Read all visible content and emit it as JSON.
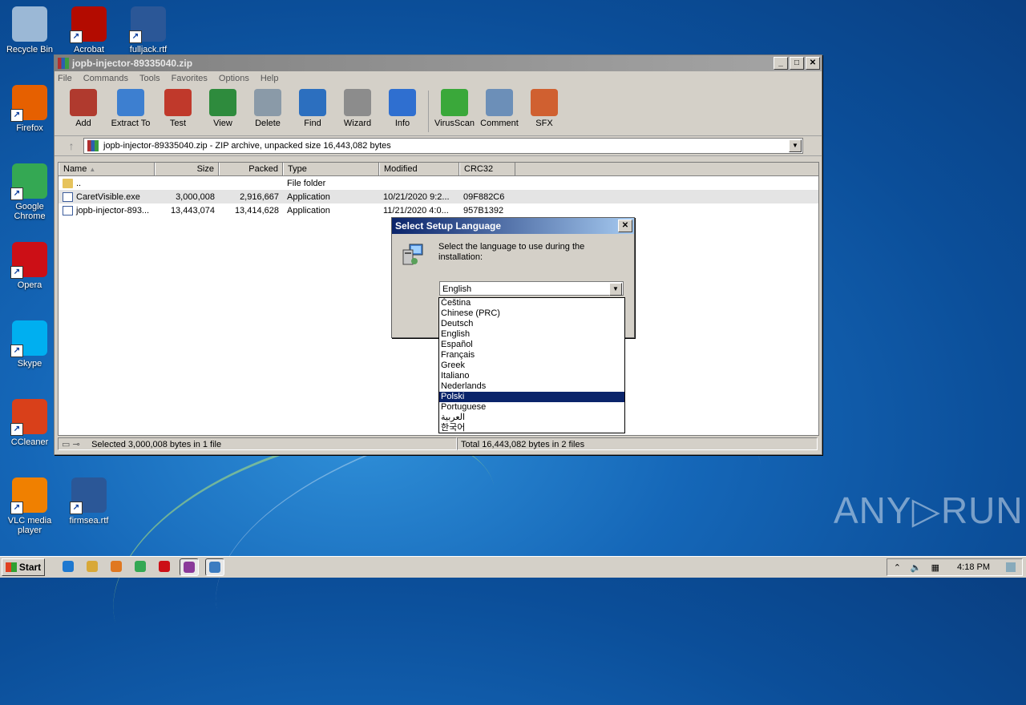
{
  "desktop": {
    "icons": [
      {
        "label": "Recycle Bin",
        "icon": "recycle-bin-icon",
        "color": "#9bb8d6"
      },
      {
        "label": "Acrobat",
        "icon": "acrobat-icon",
        "color": "#b30b00"
      },
      {
        "label": "fulljack.rtf",
        "icon": "word-document-icon",
        "color": "#2b5797"
      },
      {
        "label": "Firefox",
        "icon": "firefox-icon",
        "color": "#e66000"
      },
      {
        "label": "Google Chrome",
        "icon": "chrome-icon",
        "color": "#34a853"
      },
      {
        "label": "Opera",
        "icon": "opera-icon",
        "color": "#cc0f16"
      },
      {
        "label": "Skype",
        "icon": "skype-icon",
        "color": "#00aff0"
      },
      {
        "label": "CCleaner",
        "icon": "ccleaner-icon",
        "color": "#d9401a"
      },
      {
        "label": "VLC media player",
        "icon": "vlc-icon",
        "color": "#f08000"
      },
      {
        "label": "firmsea.rtf",
        "icon": "word-document-icon",
        "color": "#2b5797"
      }
    ],
    "watermark": "ANY▷RUN"
  },
  "window": {
    "title": "jopb-injector-89335040.zip",
    "menu": [
      "File",
      "Commands",
      "Tools",
      "Favorites",
      "Options",
      "Help"
    ],
    "toolbar": [
      {
        "label": "Add",
        "icon": "add-archive-icon",
        "color": "#b03a2e"
      },
      {
        "label": "Extract To",
        "icon": "extract-folder-icon",
        "color": "#3d7fd0"
      },
      {
        "label": "Test",
        "icon": "test-clipboard-icon",
        "color": "#c0392b"
      },
      {
        "label": "View",
        "icon": "view-book-icon",
        "color": "#2e8b3d"
      },
      {
        "label": "Delete",
        "icon": "delete-trash-icon",
        "color": "#8a9aa8"
      },
      {
        "label": "Find",
        "icon": "find-magnifier-icon",
        "color": "#2c6fbf"
      },
      {
        "label": "Wizard",
        "icon": "wizard-wand-icon",
        "color": "#8c8c8c"
      },
      {
        "label": "Info",
        "icon": "info-icon",
        "color": "#2f6fd0"
      },
      {
        "label": "VirusScan",
        "icon": "virus-scan-icon",
        "color": "#3aa83a"
      },
      {
        "label": "Comment",
        "icon": "comment-icon",
        "color": "#6c8fb8"
      },
      {
        "label": "SFX",
        "icon": "sfx-box-icon",
        "color": "#d06030"
      }
    ],
    "address": "jopb-injector-89335040.zip - ZIP archive, unpacked size 16,443,082 bytes",
    "columns": [
      "Name",
      "Size",
      "Packed",
      "Type",
      "Modified",
      "CRC32"
    ],
    "rows": [
      {
        "name": "..",
        "size": "",
        "packed": "",
        "type": "File folder",
        "modified": "",
        "crc": "",
        "kind": "folder"
      },
      {
        "name": "CaretVisible.exe",
        "size": "3,000,008",
        "packed": "2,916,667",
        "type": "Application",
        "modified": "10/21/2020 9:2...",
        "crc": "09F882C6",
        "kind": "app"
      },
      {
        "name": "jopb-injector-893...",
        "size": "13,443,074",
        "packed": "13,414,628",
        "type": "Application",
        "modified": "11/21/2020 4:0...",
        "crc": "957B1392",
        "kind": "app"
      }
    ],
    "status_left": "Selected 3,000,008 bytes in 1 file",
    "status_right": "Total 16,443,082 bytes in 2 files"
  },
  "dialog": {
    "title": "Select Setup Language",
    "message": "Select the language to use during the installation:",
    "selected": "English",
    "options": [
      "Čeština",
      "Chinese (PRC)",
      "Deutsch",
      "English",
      "Español",
      "Français",
      "Greek",
      "Italiano",
      "Nederlands",
      "Polski",
      "Portuguese",
      "العربية",
      "한국어"
    ],
    "highlighted": "Polski"
  },
  "taskbar": {
    "start_label": "Start",
    "clock": "4:18 PM",
    "apps": [
      {
        "icon": "internet-explorer-icon",
        "color": "#1e78d0"
      },
      {
        "icon": "file-explorer-icon",
        "color": "#d8a838"
      },
      {
        "icon": "media-player-icon",
        "color": "#e07820"
      },
      {
        "icon": "chrome-icon",
        "color": "#34a853"
      },
      {
        "icon": "opera-icon",
        "color": "#cc0f16"
      },
      {
        "icon": "winrar-icon",
        "color": "#8a3a9a"
      },
      {
        "icon": "setup-icon",
        "color": "#3c7cc0"
      }
    ]
  }
}
